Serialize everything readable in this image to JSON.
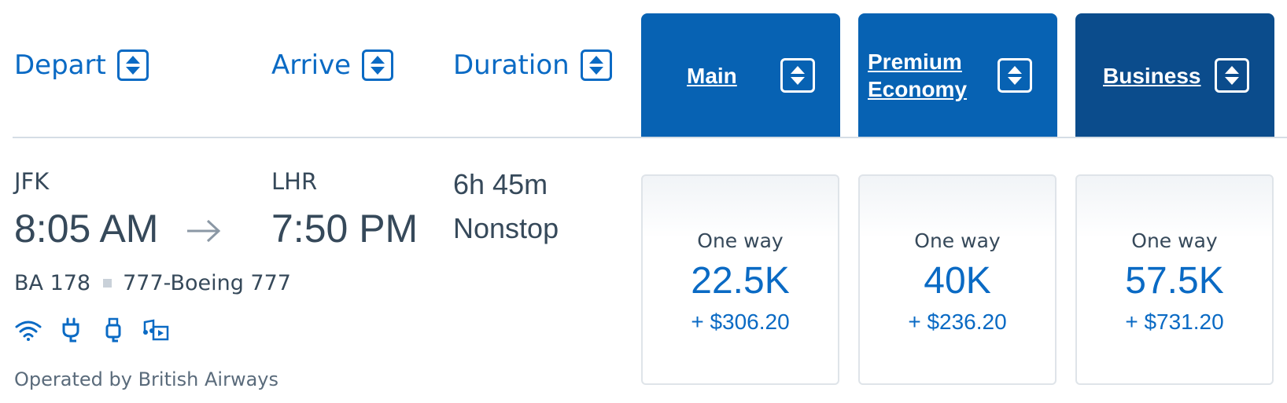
{
  "headers": {
    "depart": "Depart",
    "arrive": "Arrive",
    "duration": "Duration"
  },
  "cabins": [
    {
      "name": "Main",
      "color": "#0762b3"
    },
    {
      "name": "Premium Economy",
      "color": "#0762b3"
    },
    {
      "name": "Business",
      "color": "#0b4c8c"
    }
  ],
  "flight": {
    "origin": "JFK",
    "depart_time": "8:05 AM",
    "destination": "LHR",
    "arrive_time": "7:50 PM",
    "duration": "6h 45m",
    "stops": "Nonstop",
    "flight_number": "BA 178",
    "aircraft": "777-Boeing 777",
    "amenities": [
      "wifi-icon",
      "power-outlet-icon",
      "usb-icon",
      "entertainment-icon"
    ],
    "operated_by": "Operated by British Airways"
  },
  "fares": [
    {
      "type": "One way",
      "miles": "22.5K",
      "taxes": "+ $306.20"
    },
    {
      "type": "One way",
      "miles": "40K",
      "taxes": "+ $236.20"
    },
    {
      "type": "One way",
      "miles": "57.5K",
      "taxes": "+ $731.20"
    }
  ],
  "colors": {
    "accent_blue": "#0a6ac4",
    "cabin_main": "#0762b3",
    "cabin_business": "#0b4c8c",
    "text": "#36495a"
  }
}
